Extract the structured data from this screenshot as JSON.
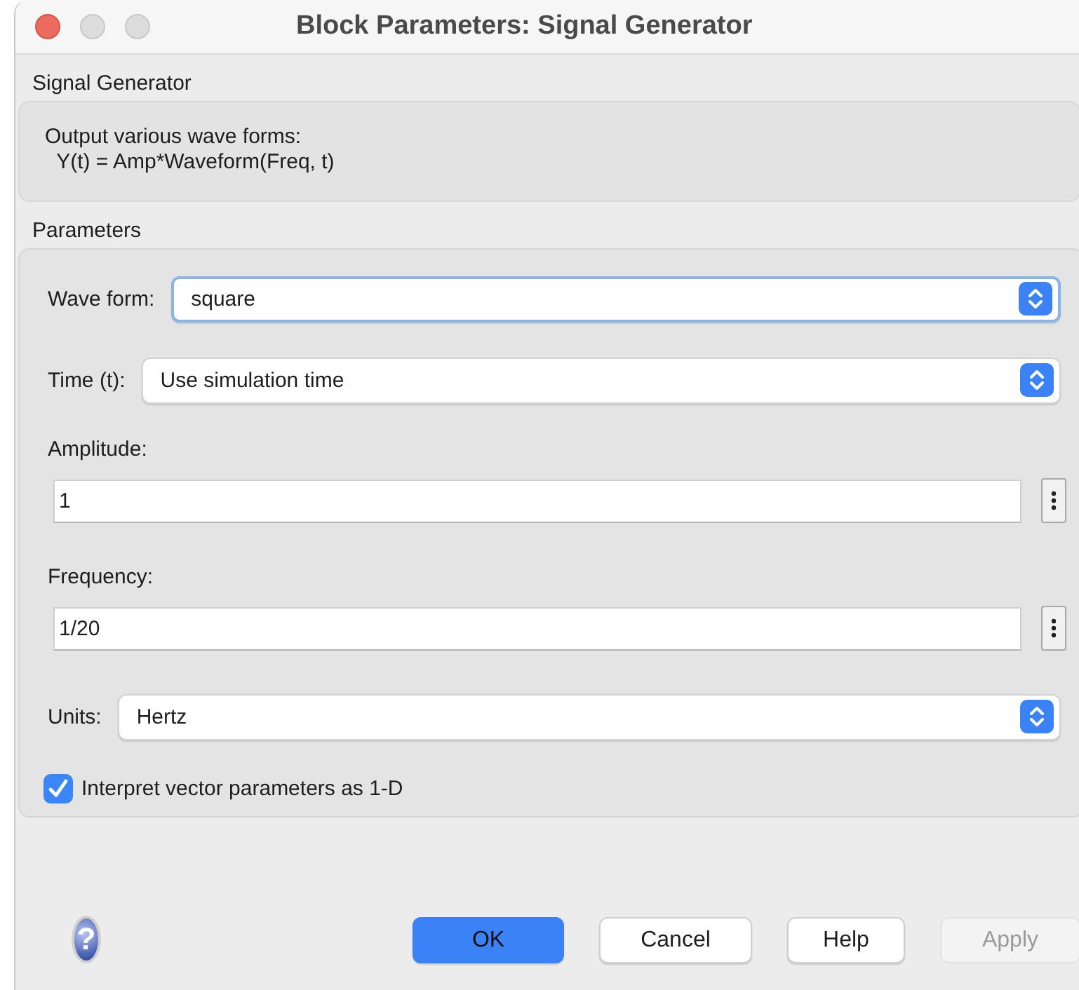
{
  "window": {
    "title": "Block Parameters: Signal Generator"
  },
  "block": {
    "name": "Signal Generator",
    "description": [
      "Output various wave forms:",
      "  Y(t) = Amp*Waveform(Freq, t)"
    ]
  },
  "parameters": {
    "title": "Parameters",
    "fields": [
      {
        "kind": "popup",
        "label": "Wave form:",
        "value": "square",
        "focused": true
      },
      {
        "kind": "popup",
        "label": "Time (t):",
        "value": "Use simulation time",
        "focused": false
      },
      {
        "kind": "edit",
        "label": "Amplitude:",
        "value": "1",
        "focused": false
      },
      {
        "kind": "edit",
        "label": "Frequency:",
        "value": "1/20",
        "focused": false
      },
      {
        "kind": "popup",
        "label": "Units:",
        "value": "Hertz",
        "focused": false
      }
    ],
    "checkbox": {
      "label": "Interpret vector parameters as 1-D",
      "checked": true
    }
  },
  "help_icon": "?",
  "buttons": [
    {
      "label": "OK",
      "default": true,
      "disabled": false
    },
    {
      "label": "Cancel",
      "default": false,
      "disabled": false
    },
    {
      "label": "Help",
      "default": false,
      "disabled": false
    },
    {
      "label": "Apply",
      "default": false,
      "disabled": true
    }
  ]
}
